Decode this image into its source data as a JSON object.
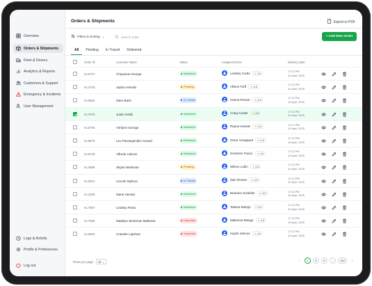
{
  "sidebar": {
    "items": [
      {
        "label": "Overview",
        "icon": "grid-icon"
      },
      {
        "label": "Orders & Shipments",
        "icon": "box-icon"
      },
      {
        "label": "Fleet & Drivers",
        "icon": "truck-icon"
      },
      {
        "label": "Analytics & Reports",
        "icon": "bar-chart-icon"
      },
      {
        "label": "Customers & Support",
        "icon": "users-icon"
      },
      {
        "label": "Emergency & Incidents",
        "icon": "alert-icon"
      },
      {
        "label": "User Management",
        "icon": "user-cog-icon"
      }
    ],
    "bottom": [
      {
        "label": "Logs & Activity",
        "icon": "clock-icon"
      },
      {
        "label": "Profile & Preferences",
        "icon": "settings-icon"
      },
      {
        "label": "Log out",
        "icon": "logout-icon"
      }
    ]
  },
  "header": {
    "title": "Orders & Shipments",
    "export_label": "Export to PDF"
  },
  "toolbar": {
    "filters_label": "Filters & Sorting",
    "search_placeholder": "Search order",
    "add_label": "+ Add New Order"
  },
  "tabs": [
    "All",
    "Pending",
    "In Transit",
    "Delivered"
  ],
  "table": {
    "headers": {
      "order_id": "Order ID",
      "customer": "Customer Name",
      "status": "Status",
      "driver": "Assigned Driver",
      "date": "Delivery Date"
    },
    "rows": [
      {
        "id": "KL9727",
        "customer": "Cheyenne George",
        "status": "Delivered",
        "driver": "Lindsey Curtis",
        "rating": "4.9",
        "time": "17:12 PM",
        "date": "10 April, 2025"
      },
      {
        "id": "KL4753",
        "customer": "Jaylon Herwitz",
        "status": "Pending",
        "driver": "Allison Torff",
        "rating": "4.8",
        "time": "17:12 PM",
        "date": "10 April, 2025"
      },
      {
        "id": "KL8864",
        "customer": "Zaire Baris",
        "status": "In Transit",
        "driver": "Hanna Rosser",
        "rating": "4.9",
        "time": "17:12 PM",
        "date": "10 April, 2025"
      },
      {
        "id": "KL7976",
        "customer": "Justin Geidt",
        "status": "Delivered",
        "driver": "Craig Carder",
        "rating": "4.8",
        "time": "17:12 PM",
        "date": "10 April, 2025"
      },
      {
        "id": "KL5706",
        "customer": "Ashlynn George",
        "status": "Delivered",
        "driver": "Rayna Herwitz",
        "rating": "4.9",
        "time": "17:12 PM",
        "date": "10 April, 2025"
      },
      {
        "id": "KL8870",
        "customer": "Leo Passaquindici Arcand",
        "status": "Delivered",
        "driver": "Omar Vorsgaard",
        "rating": "4.9",
        "time": "17:12 PM",
        "date": "10 April, 2025"
      },
      {
        "id": "KL9746",
        "customer": "Alfredo Calzoni",
        "status": "Delivered",
        "driver": "Gretchen Franci",
        "rating": "4.9",
        "time": "17:12 PM",
        "date": "10 April, 2025"
      },
      {
        "id": "KL4888",
        "customer": "Skylar Workman",
        "status": "Pending",
        "driver": "Wilson Lubin",
        "rating": "4.8",
        "time": "17:12 PM",
        "date": "10 April, 2025"
      },
      {
        "id": "KL9521",
        "customer": "Lincoln Siphron",
        "status": "In Transit",
        "driver": "Zain Rosser",
        "rating": "4.9",
        "time": "17:12 PM",
        "date": "10 April, 2025"
      },
      {
        "id": "KL3308",
        "customer": "Marie Herwitz",
        "status": "Delivered",
        "driver": "Brandon Schleifer",
        "rating": "4.9",
        "time": "17:12 PM",
        "date": "10 April, 2025"
      },
      {
        "id": "KL7957",
        "customer": "Lindsey Press",
        "status": "Delivered",
        "driver": "Tatiana Mango",
        "rating": "4.9",
        "time": "17:12 PM",
        "date": "10 April, 2025"
      },
      {
        "id": "KL7985",
        "customer": "Madelyn Workman Mathews",
        "status": "Canceled",
        "driver": "Makenna Mango",
        "rating": "4.9",
        "time": "17:12 PM",
        "date": "10 April, 2025"
      },
      {
        "id": "KL9904",
        "customer": "Cristofer Lipshutz",
        "status": "Canceled",
        "driver": "Kaylin Vetrovs",
        "rating": "4.9",
        "time": "17:12 PM",
        "date": "10 April, 2025"
      }
    ]
  },
  "footer": {
    "rows_per_page_label": "Rows per page",
    "rows_per_page_value": "10",
    "pages": [
      "1",
      "2",
      "3",
      "...",
      "112"
    ]
  },
  "colors": {
    "accent": "#16a34a",
    "delivered_bg": "#dcfce7",
    "delivered_fg": "#15803d",
    "pending_bg": "#fef3c7",
    "pending_fg": "#b45309",
    "transit_bg": "#dbeafe",
    "transit_fg": "#1d4ed8",
    "canceled_bg": "#fee2e2",
    "canceled_fg": "#dc2626"
  }
}
